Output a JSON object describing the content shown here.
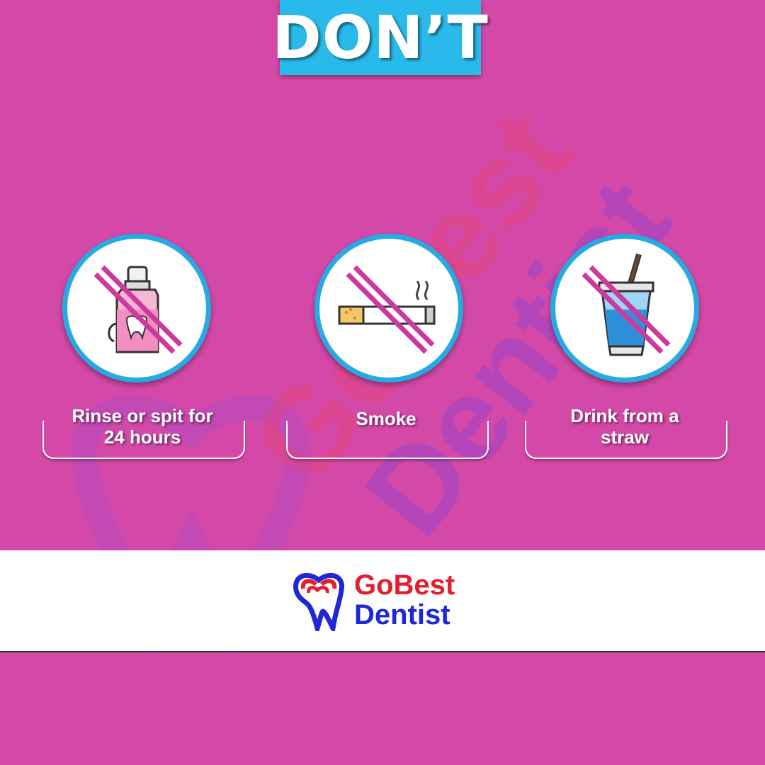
{
  "header": {
    "title": "DON’T"
  },
  "items": [
    {
      "caption": "Rinse or spit for 24 hours",
      "icon": "mouthwash-bottle-icon"
    },
    {
      "caption": "Smoke",
      "icon": "cigarette-icon"
    },
    {
      "caption": "Drink from a straw",
      "icon": "cup-with-straw-icon"
    }
  ],
  "brand": {
    "line1": "GoBest",
    "line2": "Dentist",
    "watermark_line1": "GoBest",
    "watermark_line2": "Dentist"
  },
  "colors": {
    "background": "#d449a8",
    "header_box": "#29b9ea",
    "circle_border": "#27a9e1",
    "prohibition_stroke": "#cc3aa0",
    "brand_red": "#e31e2f",
    "brand_blue": "#1f27d6"
  }
}
